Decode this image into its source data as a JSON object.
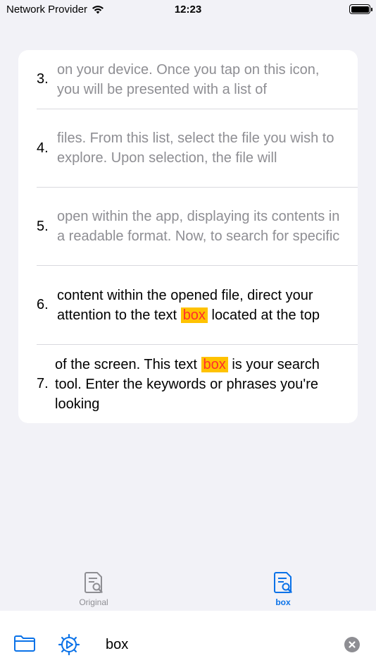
{
  "status": {
    "carrier": "Network Provider",
    "time": "12:23",
    "icons": [
      "wifi-icon",
      "battery-icon"
    ]
  },
  "results": [
    {
      "num": "3.",
      "text": "on your device. Once you tap on this icon, you will be presented with a list of",
      "dim": true
    },
    {
      "num": "4.",
      "text": "files. From this list, select the file you wish to explore. Upon selection, the file will",
      "dim": true
    },
    {
      "num": "5.",
      "text": "open within the app, displaying its contents in a readable format. Now, to search for specific",
      "dim": true
    },
    {
      "num": "6.",
      "before": "content within the opened file, direct your attention to the text ",
      "match": "box",
      "after": " located at the top",
      "dim": false
    },
    {
      "num": "7.",
      "before": "of the screen. This text ",
      "match": "box",
      "after": " is your search tool. Enter the keywords or phrases you're looking",
      "dim": false
    }
  ],
  "tabs": [
    {
      "label": "Original",
      "active": false,
      "icon": "document-search-icon"
    },
    {
      "label": "box",
      "active": true,
      "icon": "document-search-icon"
    }
  ],
  "bottom": {
    "search_value": "box",
    "icons": [
      "folder-icon",
      "gear-play-icon",
      "clear-icon"
    ]
  },
  "colors": {
    "accent": "#0a72e8",
    "highlight_bg": "#ffc200",
    "highlight_text": "#ff2d2d",
    "dim_text": "#8e8e93"
  }
}
